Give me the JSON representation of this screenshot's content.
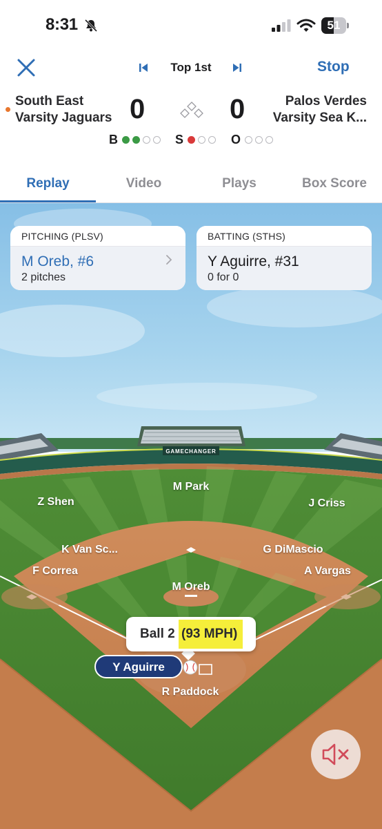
{
  "status_bar": {
    "time": "8:31",
    "battery": "51"
  },
  "nav": {
    "inning": "Top 1st",
    "stop_label": "Stop"
  },
  "scoreboard": {
    "home_team_line1": "South East",
    "home_team_line2": "Varsity Jaguars",
    "home_score": "0",
    "away_team_line1": "Palos Verdes",
    "away_team_line2": "Varsity Sea K...",
    "away_score": "0",
    "count": {
      "balls_label": "B",
      "strikes_label": "S",
      "outs_label": "O",
      "balls": 2,
      "strikes": 1,
      "outs": 0
    }
  },
  "tabs": [
    "Replay",
    "Video",
    "Plays",
    "Box Score"
  ],
  "active_tab": "Replay",
  "pitching": {
    "header": "PITCHING (PLSV)",
    "name": "M Oreb, #6",
    "detail": "2 pitches"
  },
  "batting": {
    "header": "BATTING (STHS)",
    "name": "Y Aguirre, #31",
    "detail": "0 for 0"
  },
  "field": {
    "brand": "GAMECHANGER",
    "players": {
      "center_field": "M Park",
      "left_field": "Z Shen",
      "right_field": "J Criss",
      "shortstop": "K Van Sc...",
      "second_base": "G DiMascio",
      "third_base": "F Correa",
      "first_base": "A Vargas",
      "pitcher": "M Oreb",
      "catcher": "R Paddock"
    },
    "pitch_result": "Ball 2",
    "pitch_speed": "(93 MPH)",
    "batter": "Y Aguirre"
  },
  "colors": {
    "accent": "#2f6eb5",
    "ball": "#3b9a45",
    "strike": "#d93a3a",
    "speed_highlight": "#f5ee3a",
    "batter_pill": "#1f3a78"
  },
  "icons": {
    "close": "close-icon",
    "prev": "skip-back-icon",
    "next": "skip-forward-icon",
    "mute": "speaker-muted-icon"
  }
}
